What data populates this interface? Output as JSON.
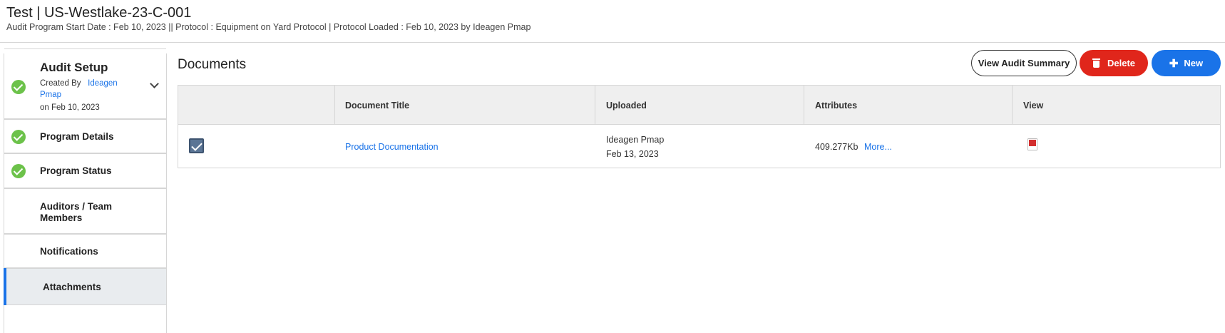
{
  "header": {
    "title": "Test | US-Westlake-23-C-001",
    "subtitle": "Audit Program Start Date : Feb 10, 2023 || Protocol : Equipment on Yard Protocol | Protocol Loaded : Feb 10, 2023 by Ideagen Pmap"
  },
  "sidebar": {
    "setup": {
      "title": "Audit Setup",
      "created_by_label": "Created By",
      "created_by_user": "Ideagen Pmap",
      "date": "on Feb 10, 2023"
    },
    "items": [
      {
        "label": "Program Details",
        "completed": true
      },
      {
        "label": "Program Status",
        "completed": true
      },
      {
        "label": "Auditors / Team Members",
        "completed": false
      },
      {
        "label": "Notifications",
        "completed": false
      },
      {
        "label": "Attachments",
        "completed": false,
        "active": true
      }
    ]
  },
  "main": {
    "title": "Documents",
    "buttons": {
      "view_summary": "View Audit Summary",
      "delete": "Delete",
      "new": "New"
    },
    "table": {
      "columns": [
        "",
        "Document Title",
        "Uploaded",
        "Attributes",
        "View"
      ],
      "rows": [
        {
          "checked": true,
          "title": "Product Documentation",
          "uploaded_by": "Ideagen Pmap",
          "uploaded_on": "Feb 13, 2023",
          "size": "409.277Kb",
          "more": "More...",
          "view_icon": "pdf-icon"
        }
      ]
    }
  },
  "colors": {
    "accent_blue": "#1a73e8",
    "danger_red": "#e0261b",
    "success_green": "#6cc24a"
  }
}
